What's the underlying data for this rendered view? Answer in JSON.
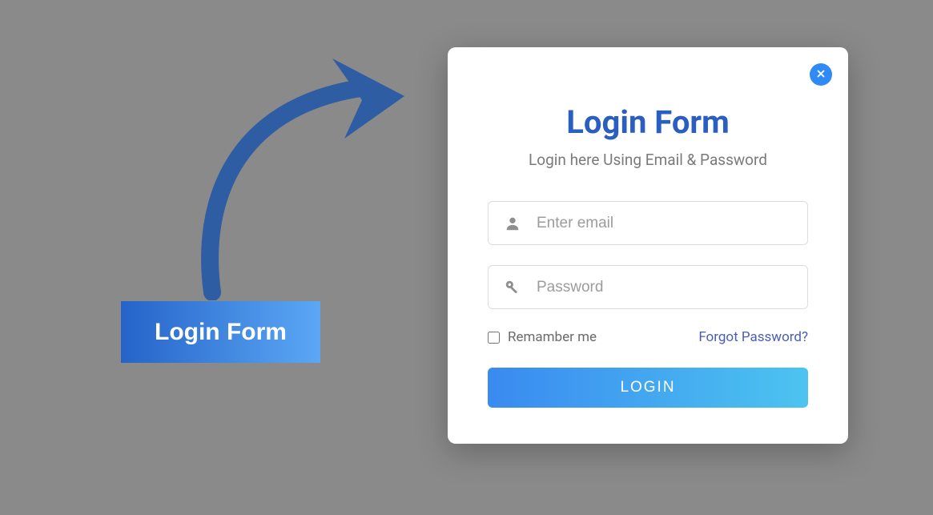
{
  "trigger": {
    "label": "Login Form"
  },
  "modal": {
    "title": "Login Form",
    "subtitle": "Login here Using Email & Password",
    "email_placeholder": "Enter email",
    "password_placeholder": "Password",
    "remember_label": "Remamber me",
    "forgot_label": "Forgot Password?",
    "submit_label": "LOGIN"
  }
}
